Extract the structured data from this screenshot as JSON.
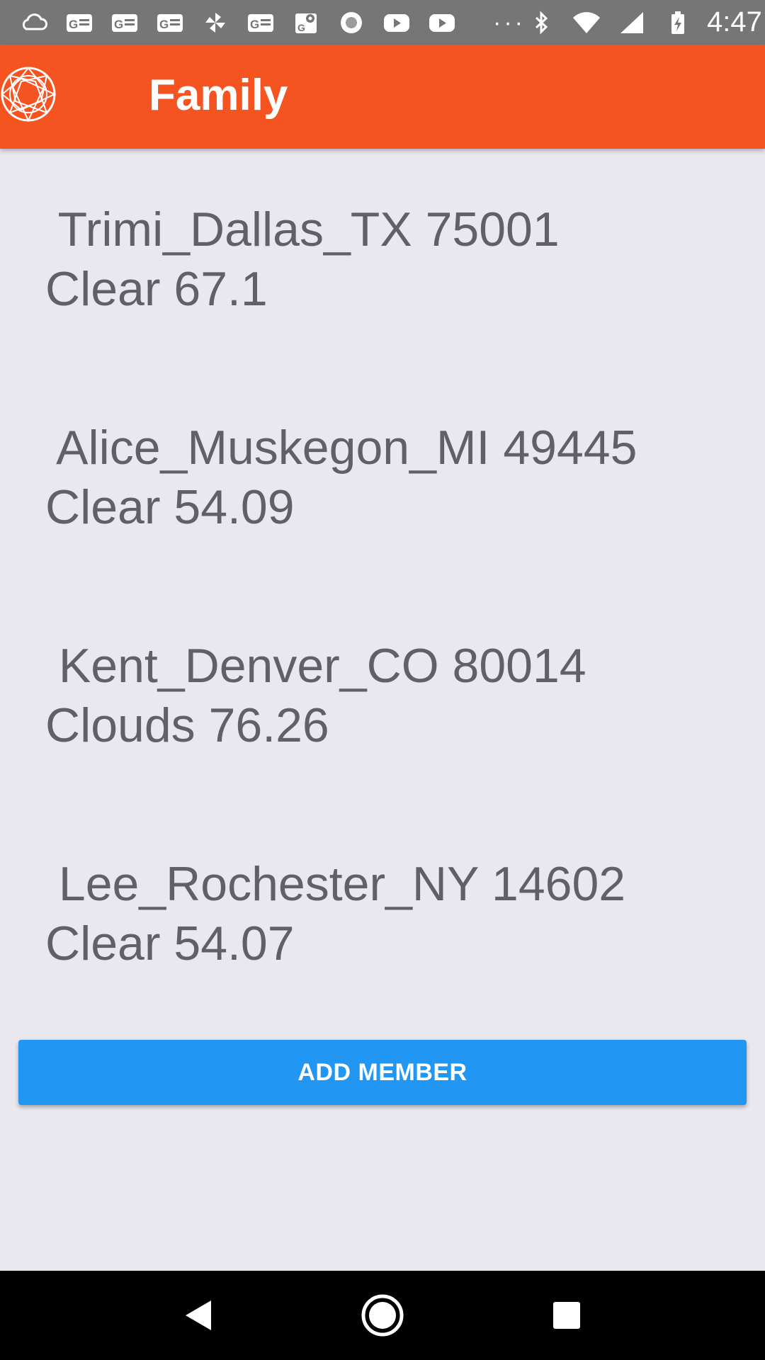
{
  "status_bar": {
    "time": "4:47",
    "more": "···",
    "icons": [
      "cloud-icon",
      "news-icon",
      "news-icon",
      "news-icon",
      "pinwheel-icon",
      "news-icon",
      "maps-icon",
      "record-icon",
      "youtube-icon",
      "youtube-icon",
      "bluetooth-icon",
      "wifi-icon",
      "signal-icon",
      "battery-charging-icon"
    ]
  },
  "app_bar": {
    "title": "Family",
    "color": "#F55420"
  },
  "members": [
    {
      "name": " Trimi_Dallas_TX 75001",
      "weather": "Clear 67.1"
    },
    {
      "name": " Alice_Muskegon_MI 49445",
      "weather": "Clear 54.09"
    },
    {
      "name": " Kent_Denver_CO 80014",
      "weather": "Clouds 76.26"
    },
    {
      "name": " Lee_Rochester_NY 14602",
      "weather": "Clear 54.07"
    }
  ],
  "add_button": {
    "label": "ADD MEMBER",
    "color": "#2196F3"
  },
  "nav_bar": {
    "buttons": [
      "back-icon",
      "home-icon",
      "recents-icon"
    ]
  }
}
